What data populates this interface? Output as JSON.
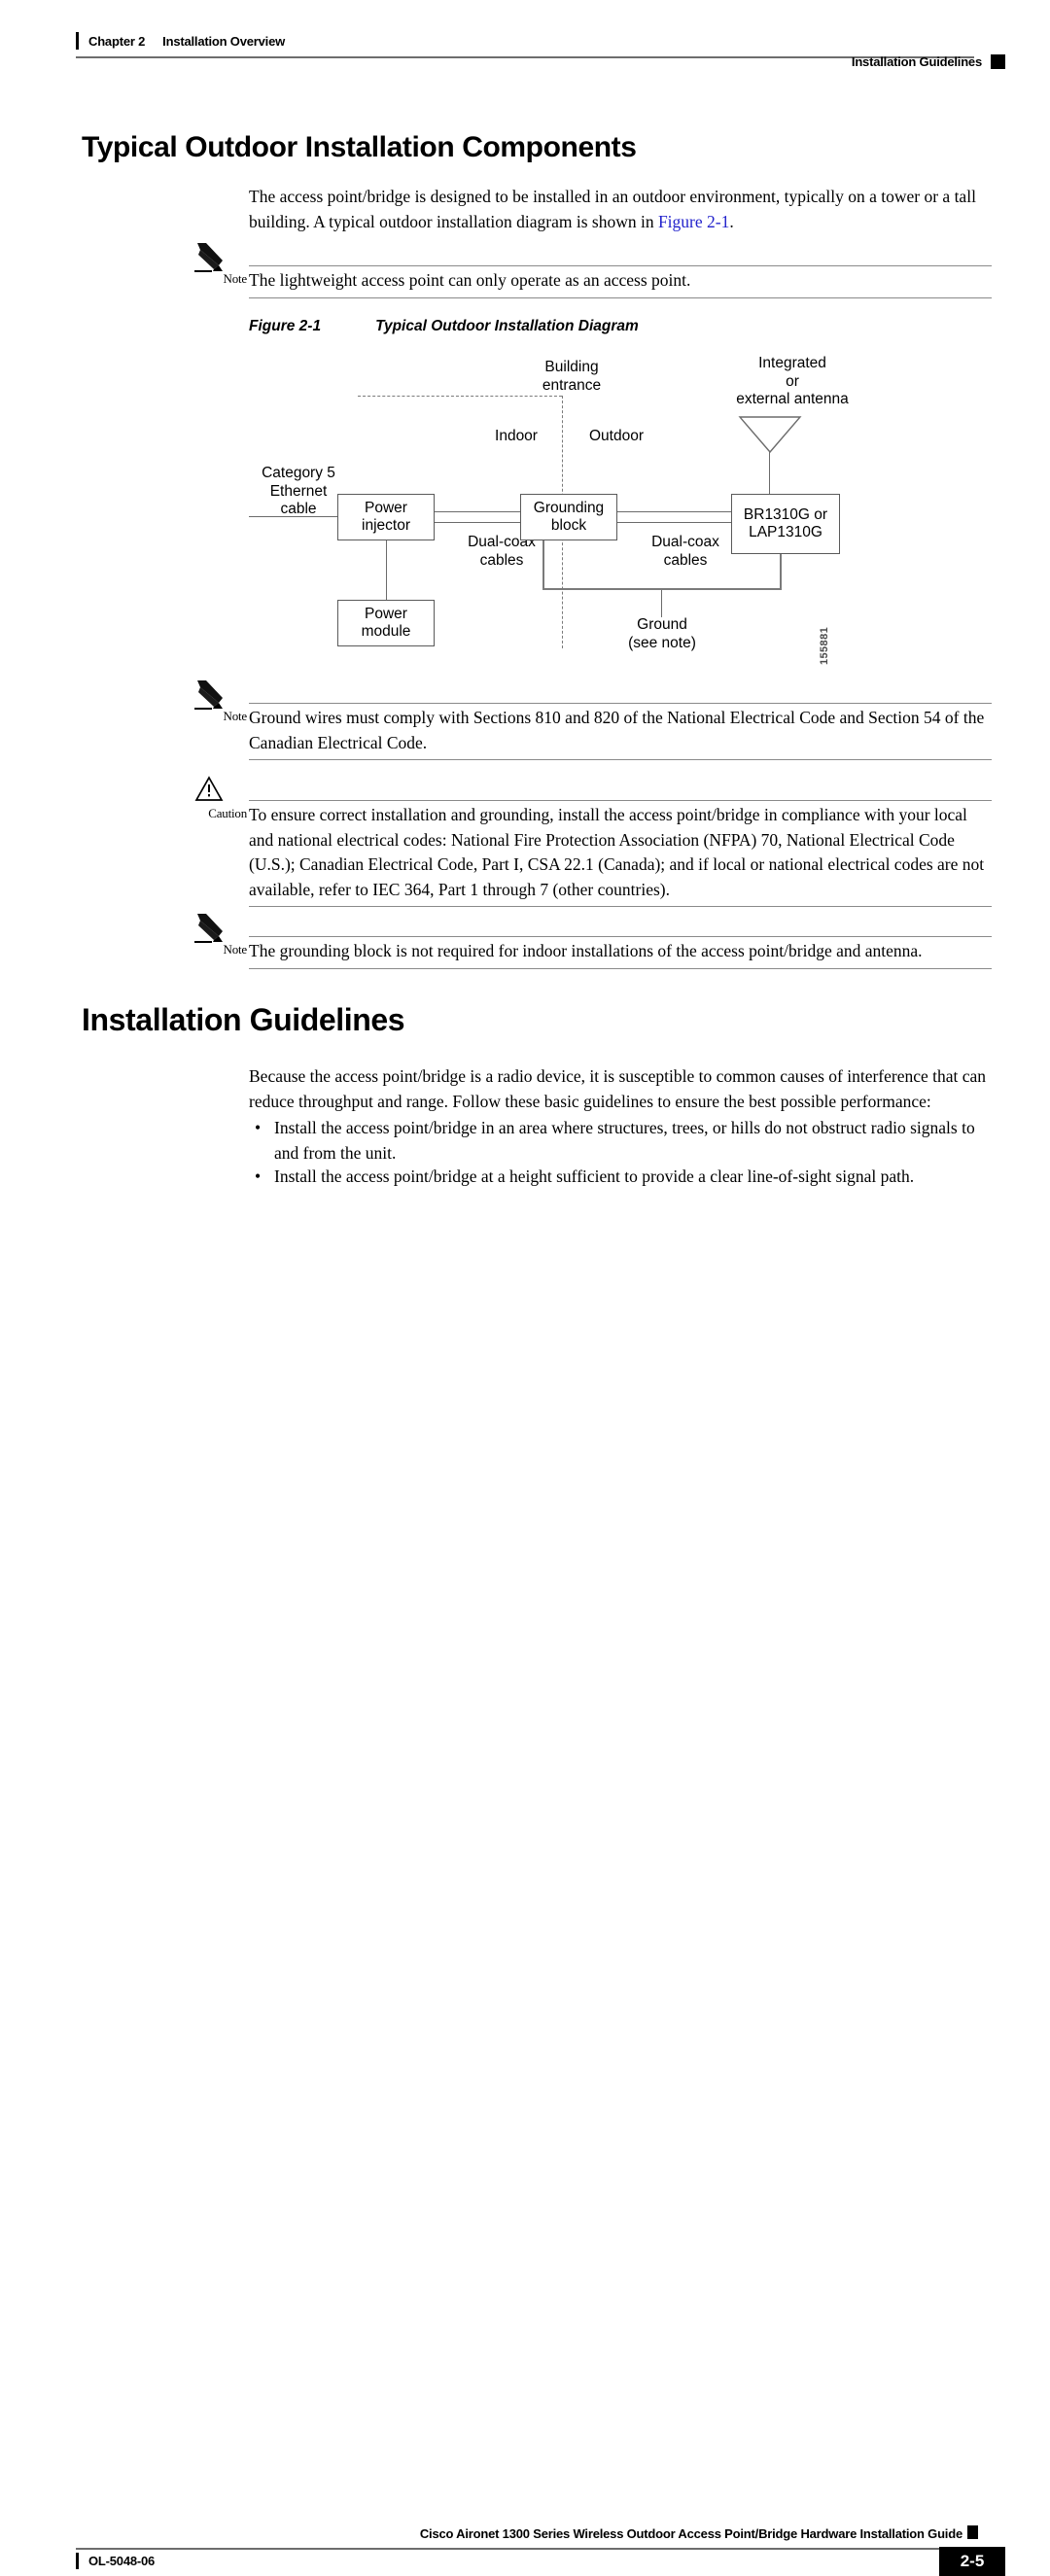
{
  "header": {
    "chapter": "Chapter 2",
    "chapter_title": "Installation Overview",
    "right_title": "Installation Guidelines"
  },
  "sections": {
    "typical_heading": "Typical Outdoor Installation Components",
    "typical_intro_part1": "The access point/bridge is designed to be installed in an outdoor environment, typically on a tower or a tall building. A typical outdoor installation diagram is shown in ",
    "typical_intro_link": "Figure 2-1",
    "typical_intro_part2": ".",
    "guidelines_heading": "Installation Guidelines",
    "guidelines_intro": "Because the access point/bridge is a radio device, it is susceptible to common causes of interference that can reduce throughput and range. Follow these basic guidelines to ensure the best possible performance:",
    "guidelines_bullets": [
      {
        "marker": "•",
        "text": "Install the access point/bridge in an area where structures, trees, or hills do not obstruct radio signals to and from the unit."
      },
      {
        "marker": "•",
        "text": "Install the access point/bridge at a height sufficient to provide a clear line-of-sight signal path."
      }
    ]
  },
  "admonitions": {
    "note1": {
      "label": "Note",
      "icon": "pencil-icon",
      "text": "The lightweight access point can only operate as an access point."
    },
    "note2": {
      "label": "Note",
      "icon": "pencil-icon",
      "text": "Ground wires must comply with Sections 810 and 820 of the National Electrical Code and Section 54 of the Canadian Electrical Code."
    },
    "caution": {
      "label": "Caution",
      "icon": "warning-triangle-icon",
      "text": "To ensure correct installation and grounding, install the access point/bridge in compliance with your local and national electrical codes: National Fire Protection Association (NFPA) 70, National Electrical Code (U.S.); Canadian Electrical Code, Part I, CSA 22.1 (Canada); and if local or national electrical codes are not available, refer to IEC 364, Part 1 through 7 (other countries)."
    },
    "note3": {
      "label": "Note",
      "icon": "pencil-icon",
      "text": "The grounding block is not required for indoor installations of the access point/bridge and antenna."
    }
  },
  "figure": {
    "label": "Figure 2-1",
    "caption": "Typical Outdoor Installation Diagram",
    "art_id": "155881",
    "boxes": {
      "power_injector": "Power\ninjector",
      "power_injector_l1": "Power",
      "power_injector_l2": "injector",
      "power_module_l1": "Power",
      "power_module_l2": "module",
      "grounding_block_l1": "Grounding",
      "grounding_block_l2": "block",
      "radio_l1": "BR1310G or",
      "radio_l2": "LAP1310G"
    },
    "labels": {
      "building_entrance_l1": "Building",
      "building_entrance_l2": "entrance",
      "antenna_l1": "Integrated",
      "antenna_l2": "or",
      "antenna_l3": "external antenna",
      "indoor": "Indoor",
      "outdoor": "Outdoor",
      "cat5_l1": "Category 5",
      "cat5_l2": "Ethernet",
      "cat5_l3": "cable",
      "dualcoax_left_l1": "Dual-coax",
      "dualcoax_left_l2": "cables",
      "dualcoax_right_l1": "Dual-coax",
      "dualcoax_right_l2": "cables",
      "ground_l1": "Ground",
      "ground_l2": "(see note)"
    }
  },
  "footer": {
    "guide_title": "Cisco Aironet 1300 Series Wireless Outdoor Access Point/Bridge Hardware Installation Guide",
    "doc_id": "OL-5048-06",
    "page_number": "2-5"
  },
  "colors": {
    "link": "#2222cc",
    "rule": "#6d6d6d",
    "admon_rule": "#8a8a8a",
    "diagram_line": "#6b6b6b"
  }
}
